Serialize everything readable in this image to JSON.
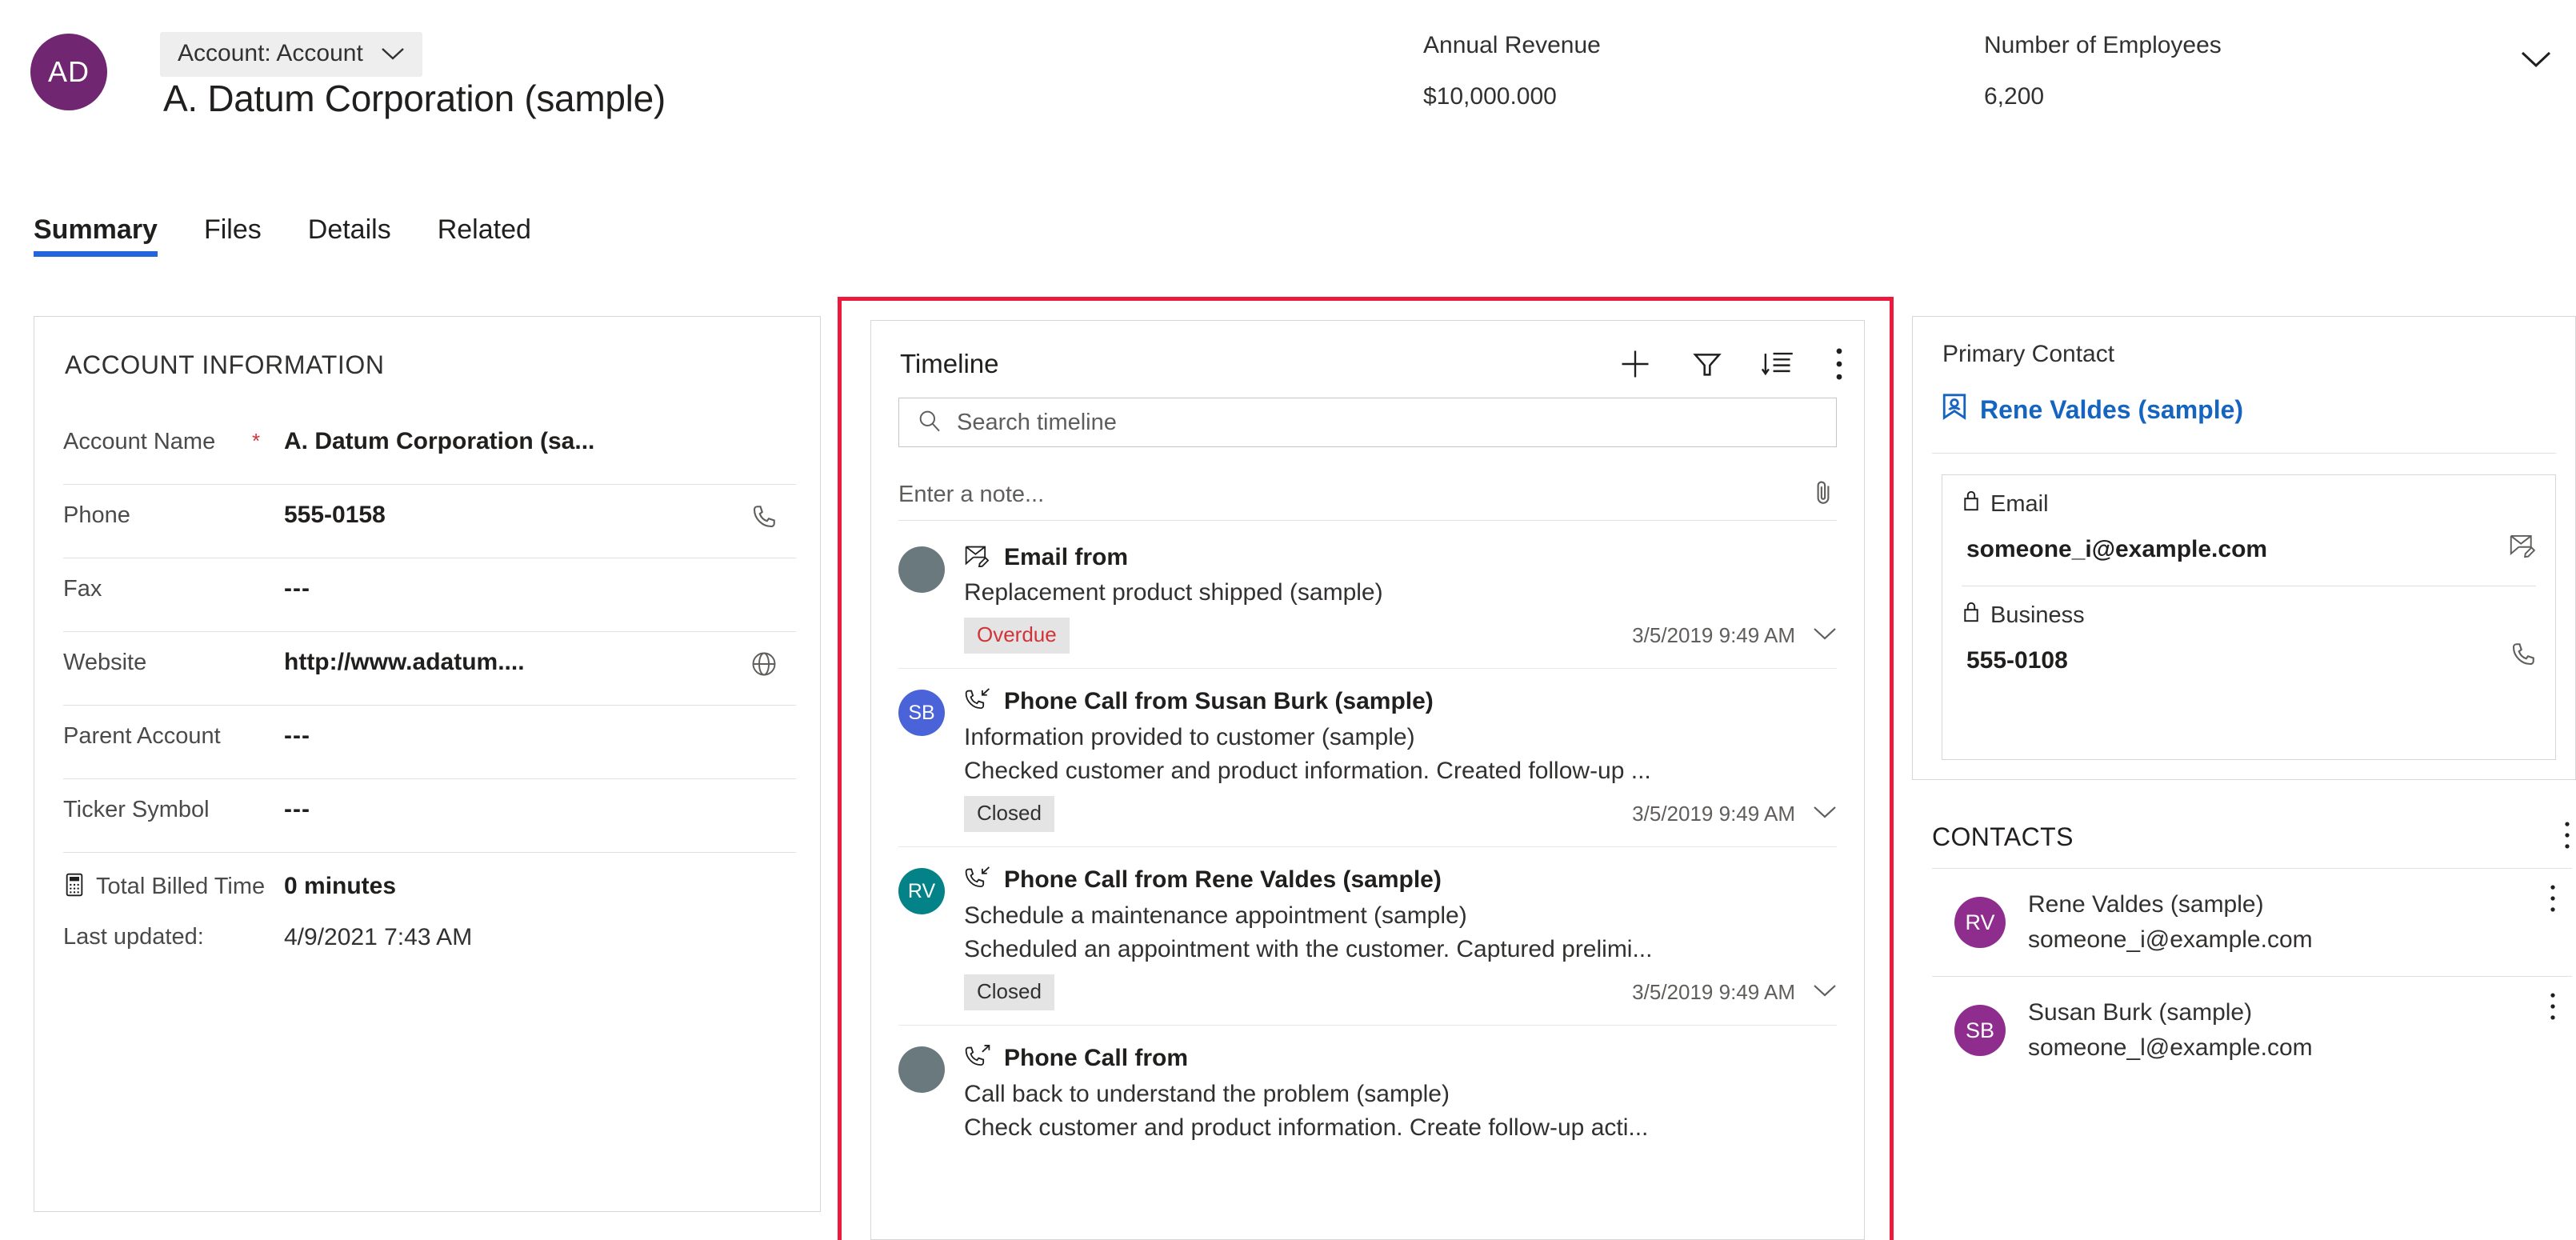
{
  "header": {
    "avatar_initials": "AD",
    "avatar_color": "#702670",
    "entity_chip": "Account: Account",
    "record_title": "A. Datum Corporation (sample)",
    "fields": [
      {
        "label": "Annual Revenue",
        "value": "$10,000.000"
      },
      {
        "label": "Number of Employees",
        "value": "6,200"
      }
    ],
    "expand_icon": "chevron-down-icon"
  },
  "tabs": [
    {
      "label": "Summary",
      "active": true
    },
    {
      "label": "Files",
      "active": false
    },
    {
      "label": "Details",
      "active": false
    },
    {
      "label": "Related",
      "active": false
    }
  ],
  "account_information": {
    "title": "ACCOUNT INFORMATION",
    "fields": [
      {
        "label": "Account Name",
        "required": "*",
        "value": "A. Datum Corporation (sa...",
        "icon": ""
      },
      {
        "label": "Phone",
        "required": "",
        "value": "555-0158",
        "icon": "phone-icon"
      },
      {
        "label": "Fax",
        "required": "",
        "value": "---",
        "icon": ""
      },
      {
        "label": "Website",
        "required": "",
        "value": "http://www.adatum....",
        "icon": "globe-icon"
      },
      {
        "label": "Parent Account",
        "required": "",
        "value": "---",
        "icon": ""
      },
      {
        "label": "Ticker Symbol",
        "required": "",
        "value": "---",
        "icon": ""
      }
    ],
    "billed": {
      "icon": "timer-icon",
      "label": "Total Billed Time",
      "value": "0 minutes"
    },
    "last_updated": {
      "label": "Last updated:",
      "value": "4/9/2021 7:43 AM"
    }
  },
  "timeline": {
    "title": "Timeline",
    "highlight_color": "#ed1a3b",
    "icons": [
      {
        "name": "add-icon"
      },
      {
        "name": "filter-icon"
      },
      {
        "name": "sort-icon"
      },
      {
        "name": "more-vertical-icon"
      }
    ],
    "search_placeholder": "Search timeline",
    "search_value": "",
    "note_placeholder": "Enter a note...",
    "note_value": "",
    "attach_icon": "paperclip-icon",
    "items": [
      {
        "avatar_initials": "",
        "avatar_color": "#69797e",
        "type_icon": "email-icon",
        "kind": "Email from",
        "subject": "Replacement product shipped (sample)",
        "description": "",
        "badge": "Overdue",
        "badge_style": "overdue",
        "time": "3/5/2019 9:49 AM"
      },
      {
        "avatar_initials": "SB",
        "avatar_color": "#4a63d8",
        "type_icon": "phone-incoming-icon",
        "kind": "Phone Call from Susan Burk (sample)",
        "subject": "Information provided to customer (sample)",
        "description": "Checked customer and product information. Created follow-up ...",
        "badge": "Closed",
        "badge_style": "closed",
        "time": "3/5/2019 9:49 AM"
      },
      {
        "avatar_initials": "RV",
        "avatar_color": "#038387",
        "type_icon": "phone-incoming-icon",
        "kind": "Phone Call from Rene Valdes (sample)",
        "subject": "Schedule a maintenance appointment (sample)",
        "description": "Scheduled an appointment with the customer. Captured prelimi...",
        "badge": "Closed",
        "badge_style": "closed",
        "time": "3/5/2019 9:49 AM"
      },
      {
        "avatar_initials": "",
        "avatar_color": "#69797e",
        "type_icon": "phone-outgoing-icon",
        "kind": "Phone Call from",
        "subject": "Call back to understand the problem (sample)",
        "description": "Check customer and product information. Create follow-up acti...",
        "badge": "",
        "badge_style": "",
        "time": ""
      }
    ]
  },
  "primary_contact": {
    "label": "Primary Contact",
    "link_icon": "contact-card-icon",
    "link_text": "Rene Valdes (sample)",
    "fields": [
      {
        "lock_icon": "lock-icon",
        "label": "Email",
        "value": "someone_i@example.com",
        "action_icon": "email-edit-icon"
      },
      {
        "lock_icon": "lock-icon",
        "label": "Business",
        "value": "555-0108",
        "action_icon": "phone-icon"
      }
    ]
  },
  "contacts": {
    "title": "CONTACTS",
    "more_icon": "more-vertical-icon",
    "items": [
      {
        "initials": "RV",
        "color": "#8e2d8e",
        "name": "Rene Valdes (sample)",
        "email": "someone_i@example.com"
      },
      {
        "initials": "SB",
        "color": "#8e2d8e",
        "name": "Susan Burk (sample)",
        "email": "someone_l@example.com"
      }
    ]
  }
}
